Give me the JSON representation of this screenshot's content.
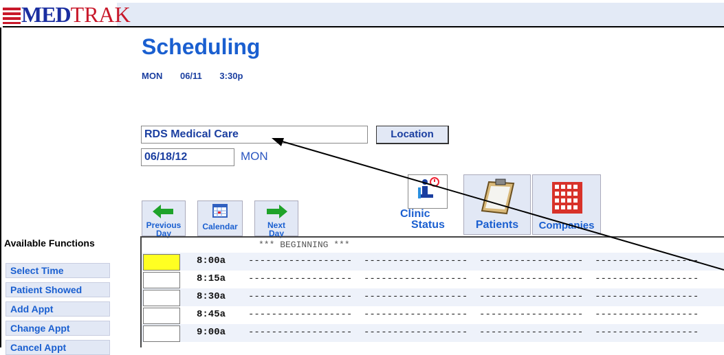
{
  "app": {
    "logo_med": "MED",
    "logo_trak": "TRAK"
  },
  "header": {
    "title": "Scheduling",
    "day": "MON",
    "date": "06/11",
    "time": "3:30p"
  },
  "location": {
    "value": "RDS Medical Care",
    "button_label": "Location"
  },
  "date_field": {
    "value": "06/18/12",
    "day_of_week": "MON"
  },
  "nav": {
    "previous_line1": "Previous",
    "previous_line2": "Day",
    "calendar": "Calendar",
    "next_line1": "Next",
    "next_line2": "Day",
    "clinic_status_line1": "Clinic",
    "clinic_status_line2": "Status",
    "patients": "Patients",
    "companies": "Companies"
  },
  "functions": {
    "heading": "Available Functions",
    "items": [
      "Select Time",
      "Patient Showed",
      "Add Appt",
      "Change Appt",
      "Cancel Appt"
    ]
  },
  "schedule": {
    "beginning": "*** BEGINNING ***",
    "dashes": "------------------  ------------------  ------------------  ------------------",
    "rows": [
      {
        "time": "8:00a"
      },
      {
        "time": "8:15a"
      },
      {
        "time": "8:30a"
      },
      {
        "time": "8:45a"
      },
      {
        "time": "9:00a"
      }
    ]
  },
  "colors": {
    "accent": "#1a5fd0",
    "selected_cell": "#ffff22",
    "panel": "#e2e8f5"
  }
}
